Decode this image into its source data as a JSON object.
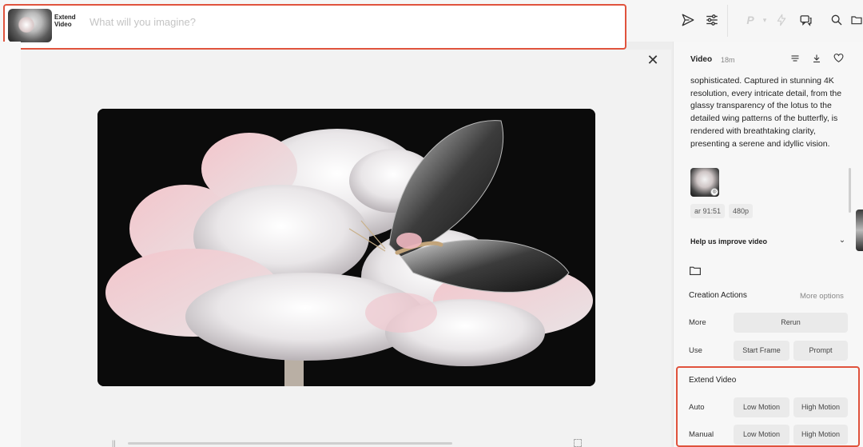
{
  "topbar": {
    "mode_label": "Extend Video",
    "prompt_placeholder": "What will you imagine?",
    "prompt_value": "",
    "model_badge": "P"
  },
  "viewer": {
    "close_symbol": "✕"
  },
  "panel": {
    "title": "Video",
    "age": "18m",
    "description": "sophisticated. Captured in stunning 4K resolution, every intricate detail, from the glassy transparency of the lotus to the detailed wing patterns of the butterfly, is rendered with breathtaking clarity, presenting a serene and idyllic vision.",
    "chips": [
      "ar 91:51",
      "480p"
    ],
    "help_label": "Help us improve video",
    "creation_actions": {
      "title": "Creation Actions",
      "more_options": "More options",
      "rows": [
        {
          "label": "More",
          "buttons": [
            "Rerun"
          ]
        },
        {
          "label": "Use",
          "buttons": [
            "Start Frame",
            "Prompt"
          ]
        }
      ]
    },
    "extend_video": {
      "title": "Extend Video",
      "rows": [
        {
          "label": "Auto",
          "buttons": [
            "Low Motion",
            "High Motion"
          ]
        },
        {
          "label": "Manual",
          "buttons": [
            "Low Motion",
            "High Motion"
          ]
        }
      ]
    }
  },
  "colors": {
    "highlight": "#e0533d",
    "button_bg": "#eaeaea",
    "panel_bg": "#f7f7f7"
  },
  "icons": [
    "send-icon",
    "settings-sliders-icon",
    "lightning-icon",
    "chat-icon",
    "search-icon",
    "folder-icon",
    "menu-icon",
    "download-icon",
    "heart-icon",
    "chevron-down-icon",
    "close-icon"
  ]
}
